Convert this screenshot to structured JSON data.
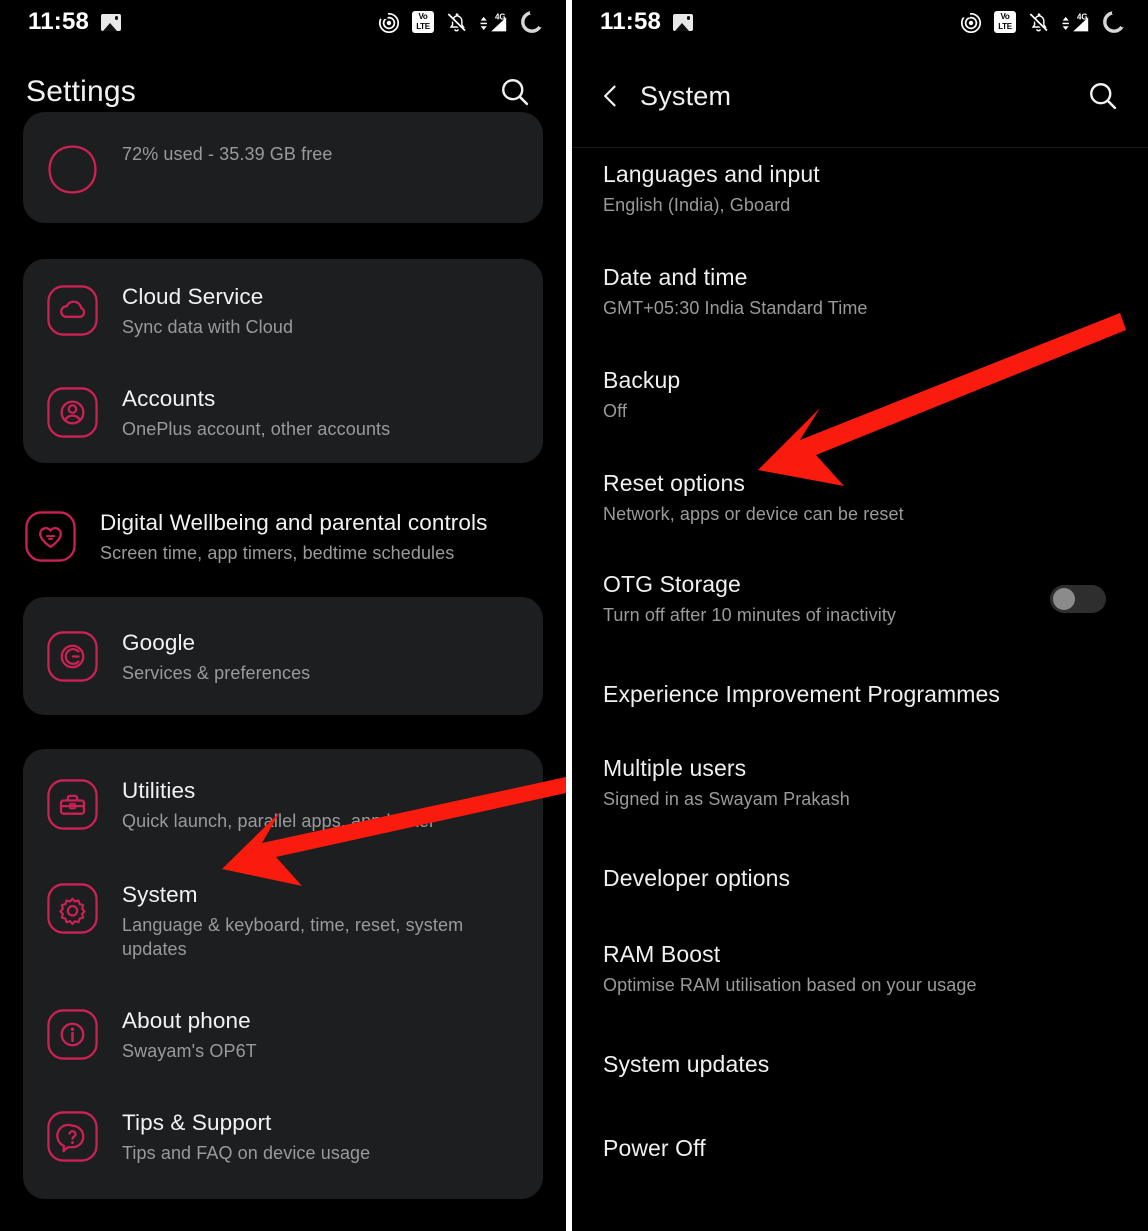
{
  "status_bar": {
    "time": "11:58",
    "left_icons": [
      "photo-icon"
    ],
    "right_icons": [
      "nearby-share-icon",
      "volte-icon",
      "notifications-muted-icon",
      "mobile-signal-4g-icon",
      "battery-icon"
    ],
    "volte_top": "Vo",
    "volte_bottom": "LTE",
    "network_label": "4G"
  },
  "accent_color": "#cc2155",
  "left_panel": {
    "title": "Settings",
    "search_icon": "search-icon",
    "groups": [
      {
        "type": "card",
        "items": [
          {
            "title": "",
            "subtitle": "72% used - 35.39 GB free",
            "icon": "storage-icon",
            "clipped": true
          }
        ]
      },
      {
        "type": "card",
        "items": [
          {
            "title": "Cloud Service",
            "subtitle": "Sync data with Cloud",
            "icon": "cloud-icon"
          },
          {
            "title": "Accounts",
            "subtitle": "OnePlus account, other accounts",
            "icon": "account-icon"
          }
        ]
      },
      {
        "type": "plain",
        "items": [
          {
            "title": "Digital Wellbeing and parental controls",
            "subtitle": "Screen time, app timers, bedtime schedules",
            "icon": "heart-icon"
          }
        ]
      },
      {
        "type": "card",
        "items": [
          {
            "title": "Google",
            "subtitle": "Services & preferences",
            "icon": "google-icon"
          }
        ]
      },
      {
        "type": "card",
        "items": [
          {
            "title": "Utilities",
            "subtitle": "Quick launch, parallel apps, app locker",
            "icon": "toolbox-icon"
          },
          {
            "title": "System",
            "subtitle": "Language & keyboard, time, reset, system updates",
            "icon": "gear-icon"
          },
          {
            "title": "About phone",
            "subtitle": "Swayam's OP6T",
            "icon": "info-icon"
          },
          {
            "title": "Tips & Support",
            "subtitle": "Tips and FAQ on device usage",
            "icon": "help-icon"
          }
        ]
      }
    ]
  },
  "right_panel": {
    "title": "System",
    "back_icon": "back-chevron-icon",
    "search_icon": "search-icon",
    "items": [
      {
        "title": "Languages and input",
        "subtitle": "English (India), Gboard",
        "toggle": null
      },
      {
        "title": "Date and time",
        "subtitle": "GMT+05:30 India Standard Time",
        "toggle": null
      },
      {
        "title": "Backup",
        "subtitle": "Off",
        "toggle": null
      },
      {
        "title": "Reset options",
        "subtitle": "Network, apps or device can be reset",
        "toggle": null
      },
      {
        "title": "OTG Storage",
        "subtitle": "Turn off after 10 minutes of inactivity",
        "toggle": "off"
      },
      {
        "title": "Experience Improvement Programmes",
        "subtitle": "",
        "toggle": null
      },
      {
        "title": "Multiple users",
        "subtitle": "Signed in as Swayam Prakash",
        "toggle": null
      },
      {
        "title": "Developer options",
        "subtitle": "",
        "toggle": null
      },
      {
        "title": "RAM Boost",
        "subtitle": "Optimise RAM utilisation based on your usage",
        "toggle": null
      },
      {
        "title": "System updates",
        "subtitle": "",
        "toggle": null
      },
      {
        "title": "Power Off",
        "subtitle": "",
        "toggle": null
      }
    ]
  },
  "annotations": {
    "arrow_color": "#f91b0d",
    "left_arrow_target": "System",
    "right_arrow_target": "Reset options"
  }
}
